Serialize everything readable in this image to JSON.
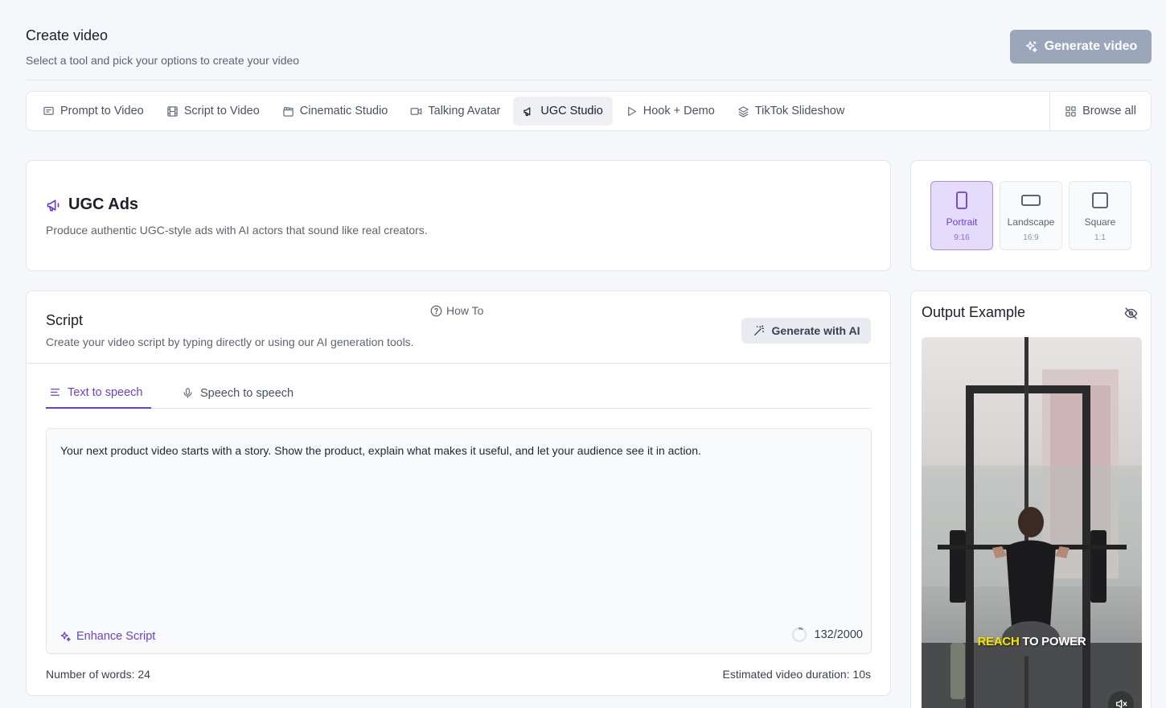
{
  "header": {
    "title": "Create video",
    "subtitle": "Select a tool and pick your options to create your video",
    "generate_button": "Generate video"
  },
  "tool_tabs": [
    {
      "label": "Prompt to Video",
      "icon": "message-square-icon"
    },
    {
      "label": "Script to Video",
      "icon": "film-icon"
    },
    {
      "label": "Cinematic Studio",
      "icon": "clapperboard-icon"
    },
    {
      "label": "Talking Avatar",
      "icon": "video-camera-icon"
    },
    {
      "label": "UGC Studio",
      "icon": "megaphone-icon",
      "active": true
    },
    {
      "label": "Hook + Demo",
      "icon": "play-icon"
    },
    {
      "label": "TikTok Slideshow",
      "icon": "layers-icon"
    }
  ],
  "browse_all": "Browse all",
  "ugc": {
    "title": "UGC Ads",
    "description": "Produce authentic UGC-style ads with AI actors that sound like real creators."
  },
  "aspect_ratios": [
    {
      "label": "Portrait",
      "ratio": "9:16",
      "active": true
    },
    {
      "label": "Landscape",
      "ratio": "16:9"
    },
    {
      "label": "Square",
      "ratio": "1:1"
    }
  ],
  "script": {
    "title": "Script",
    "description": "Create your video script by typing directly or using our AI generation tools.",
    "how_to": "How To",
    "generate_ai": "Generate with AI",
    "tabs": [
      {
        "label": "Text to speech",
        "active": true
      },
      {
        "label": "Speech to speech"
      }
    ],
    "text": "Your next product video starts with a story. Show the product, explain what makes it useful, and let your audience see it in action.",
    "enhance": "Enhance Script",
    "char_count": "132/2000",
    "char_progress": 0.066,
    "word_count": "Number of words: 24",
    "duration": "Estimated video duration: 10s"
  },
  "output": {
    "title": "Output Example",
    "caption_highlight": "REACH",
    "caption_rest": " TO POWER"
  },
  "colors": {
    "accent": "#6b3fd4",
    "accent_bg": "#e5dcfb",
    "disabled_button": "#9ba6bb"
  }
}
